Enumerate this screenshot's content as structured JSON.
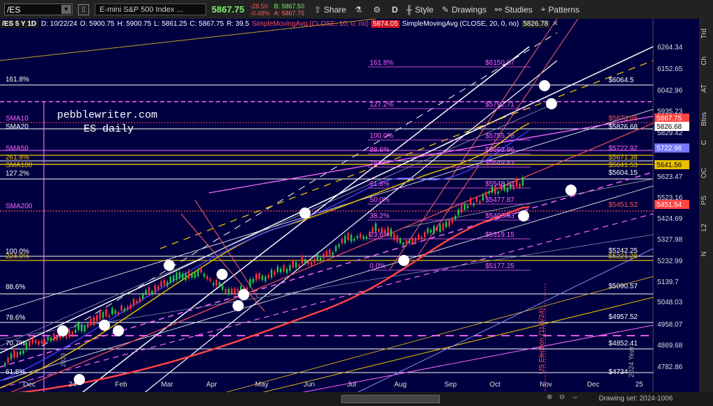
{
  "toolbar": {
    "symbol": "/ES",
    "description": "E-mini S&P 500 Index ...",
    "last": "5867.75",
    "change": "-28.50",
    "change_pct": "-0.48%",
    "bid": "B: 5867.50",
    "ask": "A: 5867.75",
    "share": "Share",
    "interval": "D",
    "style": "Style",
    "drawings": "Drawings",
    "studies": "Studies",
    "patterns": "Patterns"
  },
  "info": {
    "title": "/ES 5 Y 1D",
    "d": "D: 10/22/24",
    "o": "O: 5900.75",
    "h": "H: 5900.75",
    "l": "L: 5861.25",
    "c": "C: 5867.75",
    "r": "R: 39.5",
    "sma10": "SimpleMovingAvg (CLOSE, 10, 0, no)",
    "sma10_val": "5874.05",
    "sma20": "SimpleMovingAvg (CLOSE, 20, 0, no)",
    "sma20_val": "5826.78"
  },
  "watermark": {
    "line1": "pebblewriter.com",
    "line2": "ES daily"
  },
  "left_labels": [
    "161.8%",
    "SMA10",
    "SMA20",
    "SMA50",
    "261.8%",
    "SMA100",
    "127.2%",
    "SMA200",
    "100.0%",
    "224.0%",
    "88.6%",
    "78.6%",
    "70.7%",
    "61.8%"
  ],
  "fib_labels": [
    "161.8%",
    "127.2%",
    "100.0%",
    "88.6%",
    "78.6%",
    "61.8%",
    "50.0%",
    "38.2%",
    "23.6%",
    "0.0%"
  ],
  "fib_prices": [
    "$6150.07",
    "$5792.71",
    "$5755.78",
    "$5692.96",
    "$5649.83",
    "$5548.82",
    "$5477.87",
    "$5406.93",
    "$5319.15",
    "$5177.25"
  ],
  "right_labels": [
    "$6064.5",
    "$5873.88",
    "$5826.68",
    "$5722.92",
    "$5671.38",
    "$5641.53",
    "$5604.15",
    "$5451.52",
    "$5242.25",
    "$5221.28",
    "$5090.57",
    "$4957.52",
    "$4852.41",
    "$4734"
  ],
  "axis_prices": [
    "6264.34",
    "6152.65",
    "6042.96",
    "5935.23",
    "5829.42",
    "5623.47",
    "5523.16",
    "5424.69",
    "5327.98",
    "5232.99",
    "5139.7",
    "5048.03",
    "4958.07",
    "4869.68",
    "4782.86"
  ],
  "axis_tags": [
    "5867.75",
    "5826.68",
    "5722.96",
    "5641.56",
    "5451.54"
  ],
  "months": [
    "Dec",
    "24",
    "Feb",
    "Mar",
    "Apr",
    "May",
    "Jun",
    "Jul",
    "Aug",
    "Sep",
    "Oct",
    "Nov",
    "Dec",
    "25"
  ],
  "annotations": {
    "election": "US Election (11/5/24)",
    "year_note": "2024 Year",
    "left_note": "2023"
  },
  "right_rail": [
    "Trd",
    "Ch",
    "AT",
    "Btns",
    "C",
    "OC",
    "PS",
    "L2",
    "N"
  ],
  "bottom": {
    "drawing_set": "Drawing set: 2024-1006"
  },
  "colors": {
    "background": "#000040",
    "up": "#22cc44",
    "down": "#ff3333",
    "sma10": "#ff4444",
    "sma20": "#ffffff",
    "sma50": "#ff66ff",
    "sma100": "#e8c000",
    "sma200": "#ff6666"
  }
}
